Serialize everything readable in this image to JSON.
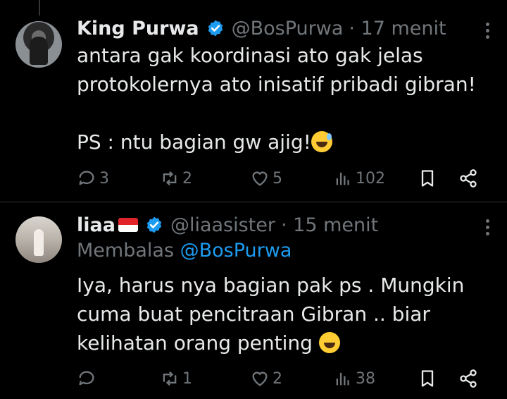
{
  "tweets": [
    {
      "name": "King Purwa",
      "handle": "@BosPurwa",
      "time": "· 17 menit",
      "body_line1": "antara gak koordinasi ato gak jelas",
      "body_line2": "protokolernya ato inisatif pribadi gibran!",
      "body_line3": "PS : ntu bagian gw ajig!",
      "emoji": "sweat-smile-emoji",
      "replies": "3",
      "reposts": "2",
      "likes": "5",
      "views": "102"
    },
    {
      "name": "liaa",
      "flag": "indonesia-flag",
      "handle": "@liaasister",
      "time": "· 15 menit",
      "reply_prefix": "Membalas",
      "reply_handle": "@BosPurwa",
      "body_line1": "Iya, harus nya bagian pak ps . Mungkin",
      "body_line2": "cuma buat pencitraan Gibran .. biar",
      "body_line3": "kelihatan orang penting",
      "emoji": "grinning-emoji",
      "replies": "",
      "reposts": "1",
      "likes": "2",
      "views": "38"
    }
  ],
  "colors": {
    "background": "#000000",
    "text": "#e7e9ea",
    "muted": "#71767b",
    "link": "#1d9bf0",
    "verified": "#1d9bf0"
  }
}
